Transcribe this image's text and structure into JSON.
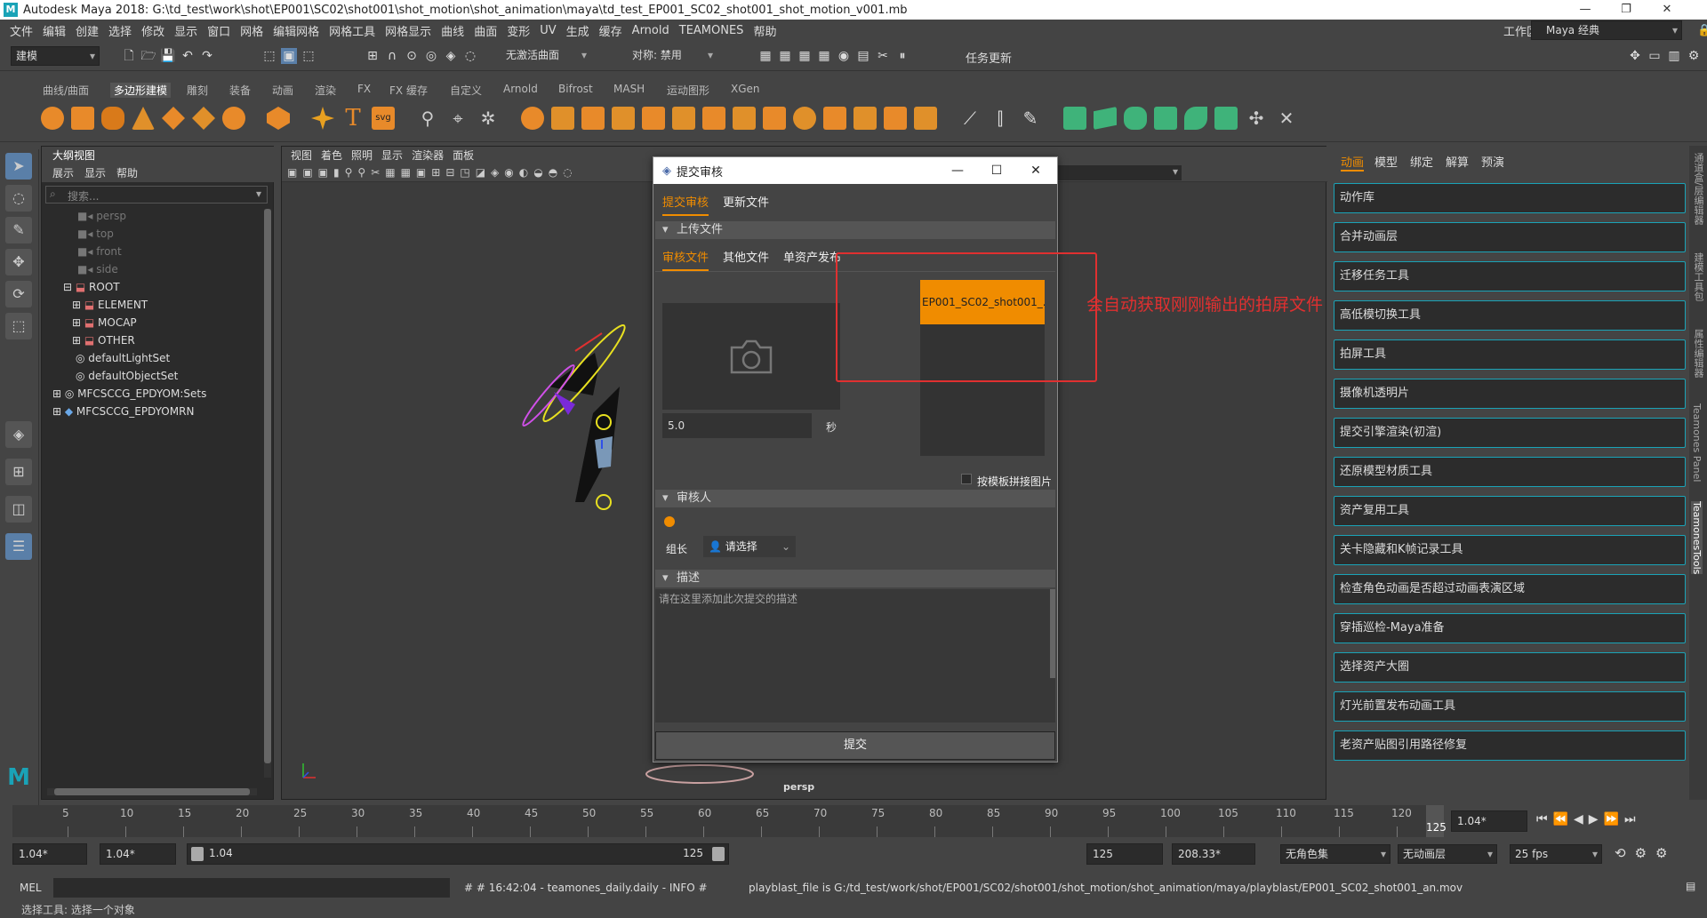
{
  "window": {
    "title": "Autodesk Maya 2018: G:\\td_test\\work\\shot\\EP001\\SC02\\shot001\\shot_motion\\shot_animation\\maya\\td_test_EP001_SC02_shot001_shot_motion_v001.mb"
  },
  "menubar": [
    "文件",
    "编辑",
    "创建",
    "选择",
    "修改",
    "显示",
    "窗口",
    "网格",
    "编辑网格",
    "网格工具",
    "网格显示",
    "曲线",
    "曲面",
    "变形",
    "UV",
    "生成",
    "缓存",
    "Arnold",
    "TEAMONES",
    "帮助"
  ],
  "workspace": {
    "label": "工作区:",
    "value": "Maya 经典"
  },
  "toolbar": {
    "mode": "建模",
    "live_surface": "无激活曲面",
    "symmetry": "对称: 禁用",
    "task_update": "任务更新"
  },
  "shelf_tabs": [
    "曲线/曲面",
    "多边形建模",
    "雕刻",
    "装备",
    "动画",
    "渲染",
    "FX",
    "FX 缓存",
    "自定义",
    "Arnold",
    "Bifrost",
    "MASH",
    "运动图形",
    "XGen"
  ],
  "shelf_active": "多边形建模",
  "outliner": {
    "title": "大纲视图",
    "menu": [
      "展示",
      "显示",
      "帮助"
    ],
    "search_placeholder": "搜索...",
    "items": [
      {
        "label": "persp",
        "dim": true
      },
      {
        "label": "top",
        "dim": true
      },
      {
        "label": "front",
        "dim": true
      },
      {
        "label": "side",
        "dim": true
      },
      {
        "label": "ROOT",
        "dim": false
      },
      {
        "label": "ELEMENT",
        "dim": false
      },
      {
        "label": "MOCAP",
        "dim": false
      },
      {
        "label": "OTHER",
        "dim": false
      },
      {
        "label": "defaultLightSet",
        "dim": false
      },
      {
        "label": "defaultObjectSet",
        "dim": false
      },
      {
        "label": "MFCSCCG_EPDYOM:Sets",
        "dim": false
      },
      {
        "label": "MFCSCCG_EPDYOMRN",
        "dim": false
      }
    ]
  },
  "viewport": {
    "menu": [
      "视图",
      "着色",
      "照明",
      "显示",
      "渲染器",
      "面板"
    ],
    "camera": "persp"
  },
  "dialog": {
    "title": "提交审核",
    "tabs": [
      "提交审核",
      "更新文件"
    ],
    "upload_section": "上传文件",
    "subtabs": [
      "审核文件",
      "其他文件",
      "单资产发布"
    ],
    "duration": "5.0",
    "duration_unit": "秒",
    "file_item": "EP001_SC02_shot001_...",
    "template_checkbox": "按模板拼接图片",
    "reviewer_section": "审核人",
    "reviewer_role": "组长",
    "reviewer_select": "请选择",
    "desc_section": "描述",
    "desc_placeholder": "请在这里添加此次提交的描述",
    "submit": "提交"
  },
  "annotation": "会自动获取刚刚输出的拍屏文件",
  "rightpanel": {
    "tabs": [
      "动画",
      "模型",
      "绑定",
      "解算",
      "预演"
    ],
    "active_tab": "动画",
    "buttons": [
      "动作库",
      "合并动画层",
      "迁移任务工具",
      "高低模切换工具",
      "拍屏工具",
      "摄像机透明片",
      "提交引擎渲染(初渲)",
      "还原模型材质工具",
      "资产复用工具",
      "关卡隐藏和K帧记录工具",
      "检查角色动画是否超过动画表演区域",
      "穿插巡检-Maya准备",
      "选择资产大圈",
      "灯光前置发布动画工具",
      "老资产贴图引用路径修复"
    ],
    "vertical_tabs": [
      "通道盒/层编辑器",
      "建模工具包",
      "属性编辑器",
      "Teamones Panel",
      "TeamonesTools"
    ]
  },
  "timeline": {
    "ticks": [
      "5",
      "10",
      "15",
      "20",
      "25",
      "30",
      "35",
      "40",
      "45",
      "50",
      "55",
      "60",
      "65",
      "70",
      "75",
      "80",
      "85",
      "90",
      "95",
      "100",
      "105",
      "110",
      "115",
      "120",
      "125"
    ],
    "current": "1.04*",
    "end_marker": "125"
  },
  "range": {
    "start": "1.04*",
    "start2": "1.04*",
    "slider_start": "1.04",
    "slider_end": "125",
    "end": "125",
    "end2": "208.33*",
    "charset": "无角色集",
    "anim_layer": "无动画层",
    "fps": "25 fps"
  },
  "cmdline": {
    "label": "MEL",
    "log": "# # 16:42:04 - teamones_daily.daily - INFO  #",
    "result": "playblast_file is G:/td_test/work/shot/EP001/SC02/shot001/shot_motion/shot_animation/maya/playblast/EP001_SC02_shot001_an.mov"
  },
  "status": "选择工具: 选择一个对象",
  "colors": {
    "accent": "#f08c00",
    "teal": "#1aa3b7",
    "annotation": "#e03030"
  }
}
